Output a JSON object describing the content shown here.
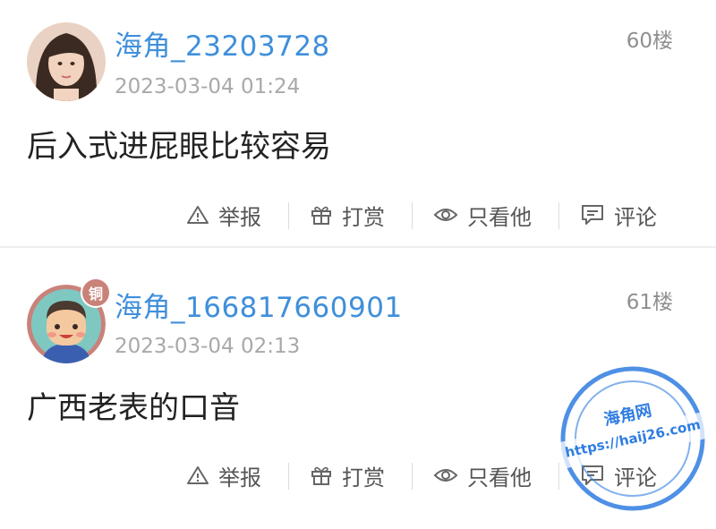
{
  "posts": [
    {
      "username": "海角_23203728",
      "time": "2023-03-04 01:24",
      "floor": "60楼",
      "content": "后入式进屁眼比较容易"
    },
    {
      "username": "海角_166817660901",
      "time": "2023-03-04 02:13",
      "floor": "61楼",
      "content": "广西老表的口音",
      "badge": "铜"
    }
  ],
  "actions": {
    "report": "举报",
    "reward": "打赏",
    "only_him": "只看他",
    "comment": "评论"
  },
  "watermark": {
    "line1": "海角网",
    "line2": "https://haij26.com"
  },
  "colors": {
    "username": "#3f8fdb",
    "time": "#a9a9a9",
    "action_text": "#555555",
    "stamp": "#2f7de1"
  }
}
